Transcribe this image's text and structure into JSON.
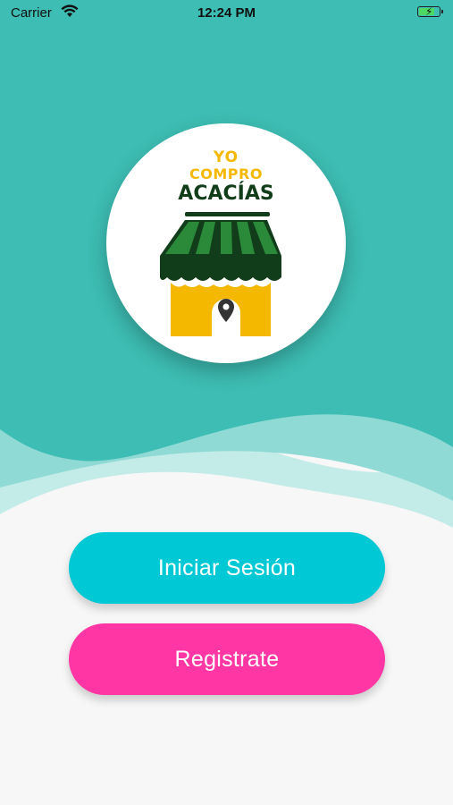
{
  "status_bar": {
    "carrier": "Carrier",
    "time": "12:24 PM",
    "wifi_icon": "wifi-icon",
    "battery_icon": "battery-charging-icon"
  },
  "logo": {
    "line1": "YO",
    "line2": "COMPRO",
    "line3": "ACACÍAS",
    "icon": "store-awning-location-pin"
  },
  "actions": {
    "login_label": "Iniciar Sesión",
    "register_label": "Registrate"
  },
  "colors": {
    "teal_top": "#3dbdb3",
    "wave_light": "#8fdad4",
    "wave_lighter": "#c3ebe8",
    "background": "#f7f7f7",
    "login_button": "#00c8d4",
    "register_button": "#ff36a3",
    "logo_yellow": "#f5b800",
    "logo_green": "#1e7a2d",
    "logo_dark_green": "#123d1a"
  }
}
